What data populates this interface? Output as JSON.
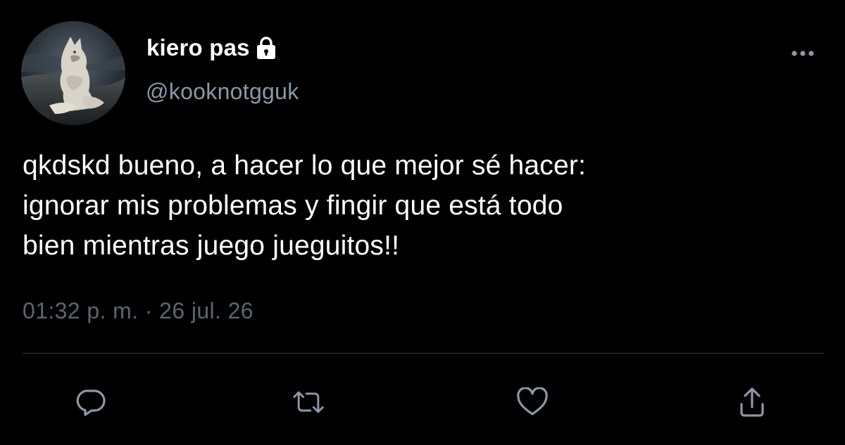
{
  "user": {
    "display_name": "kiero pas",
    "handle": "@kooknotgguk",
    "avatar_icon": "wolf-avatar",
    "protected_icon": "lock-icon"
  },
  "tweet": {
    "text": "qkdskd bueno, a hacer lo que mejor sé hacer:\nignorar mis problemas y fingir que está todo\nbien mientras juego jueguitos!!",
    "timestamp": "01:32 p. m. · 26 jul. 26"
  },
  "actions": {
    "reply_icon": "reply-icon",
    "retweet_icon": "retweet-icon",
    "like_icon": "heart-icon",
    "share_icon": "share-icon",
    "more_icon": "more-icon"
  },
  "colors": {
    "background": "#000000",
    "primary_text": "#ffffff",
    "secondary_text": "#8b98a5",
    "timestamp_text": "#5c6670",
    "icon": "#8b98a5",
    "divider": "#2f3336"
  }
}
